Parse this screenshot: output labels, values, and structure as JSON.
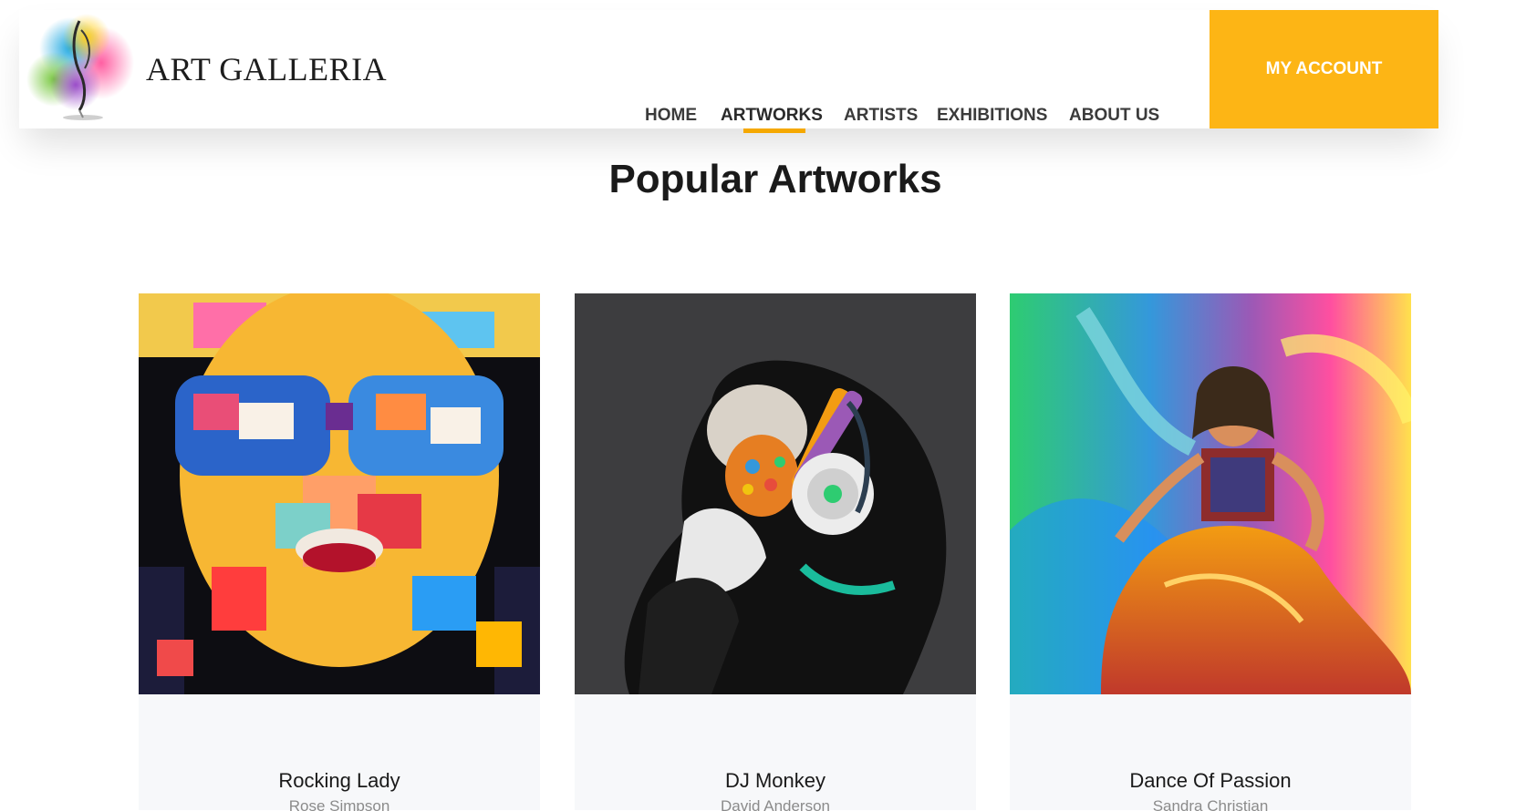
{
  "brand": {
    "name": "ART GALLERIA",
    "logo_icon": "paint-splash-brush-icon"
  },
  "nav": {
    "items": [
      {
        "label": "HOME",
        "active": false
      },
      {
        "label": "ARTWORKS",
        "active": true
      },
      {
        "label": "ARTISTS",
        "active": false
      },
      {
        "label": "EXHIBITIONS",
        "active": false
      },
      {
        "label": "ABOUT US",
        "active": false
      }
    ],
    "account_label": "MY ACCOUNT"
  },
  "section": {
    "title": "Popular Artworks"
  },
  "artworks": [
    {
      "title": "Rocking Lady",
      "artist": "Rose Simpson"
    },
    {
      "title": "DJ Monkey",
      "artist": "David Anderson"
    },
    {
      "title": "Dance Of Passion",
      "artist": "Sandra Christian"
    }
  ],
  "colors": {
    "accent": "#fdb515",
    "active_underline": "#f5a800",
    "nav_text": "#3b3b3b",
    "artist_text": "#8b8b8b",
    "card_bg": "#f7f8fa"
  }
}
